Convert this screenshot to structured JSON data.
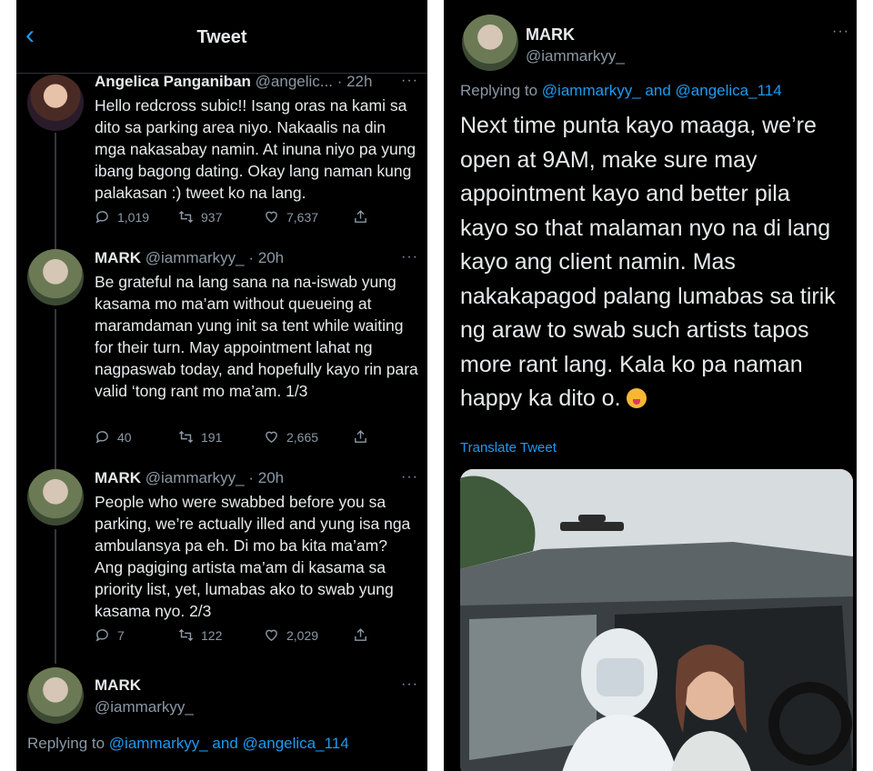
{
  "left_panel": {
    "header": {
      "back_icon": "chevron-left-icon",
      "title": "Tweet"
    },
    "tweets": [
      {
        "name": "Angelica Panganiban",
        "handle": "@angelic...",
        "time": "· 22h",
        "more": "···",
        "text": "Hello redcross subic!! Isang oras na kami sa dito sa parking area niyo. Nakaalis na din mga nakasabay namin. At inuna niyo pa yung ibang bagong dating. Okay lang naman kung palakasan :) tweet ko na lang.",
        "replies": "1,019",
        "retweets": "937",
        "likes": "7,637"
      },
      {
        "name": "MARK",
        "handle": "@iammarkyy_",
        "time": "· 20h",
        "more": "···",
        "text": "Be grateful na lang sana na na-iswab yung kasama mo ma’am without queueing at maramdaman yung init sa tent while waiting for their turn. May appointment lahat ng nagpaswab today, and hopefully kayo rin para valid ‘tong rant mo ma’am. 1/3",
        "replies": "40",
        "retweets": "191",
        "likes": "2,665"
      },
      {
        "name": "MARK",
        "handle": "@iammarkyy_",
        "time": "· 20h",
        "more": "···",
        "text": "People who were swabbed before you sa parking, we’re actually illed and yung isa nga ambulansya pa eh. Di mo ba kita ma’am? Ang pagiging artista ma’am di kasama sa priority list, yet, lumabas ako to swab yung kasama nyo. 2/3",
        "replies": "7",
        "retweets": "122",
        "likes": "2,029"
      }
    ],
    "last_tweet": {
      "name": "MARK",
      "handle": "@iammarkyy_",
      "more": "···",
      "replying_prefix": "Replying to",
      "mention_1": "@iammarkyy_",
      "and": "and",
      "mention_2": "@angelica_114"
    }
  },
  "right_panel": {
    "name": "MARK",
    "handle": "@iammarkyy_",
    "more": "···",
    "replying_prefix": "Replying to",
    "mention_1": "@iammarkyy_",
    "and": "and",
    "mention_2": "@angelica_114",
    "text": "Next time punta kayo maaga, we’re open at 9AM, make sure may appointment kayo and better pila kayo so that malaman nyo na di lang kayo ang client namin. Mas nakakapagod palang lumabas sa tirik ng araw to swab such artists tapos more rant lang. Kala ko pa naman happy ka dito o.",
    "emoji": "face-with-tongue-emoji",
    "translate": "Translate Tweet"
  },
  "colors": {
    "background": "#000000",
    "accent": "#1d9bf0",
    "muted": "#8b98a5",
    "text": "#e7e9ea"
  }
}
